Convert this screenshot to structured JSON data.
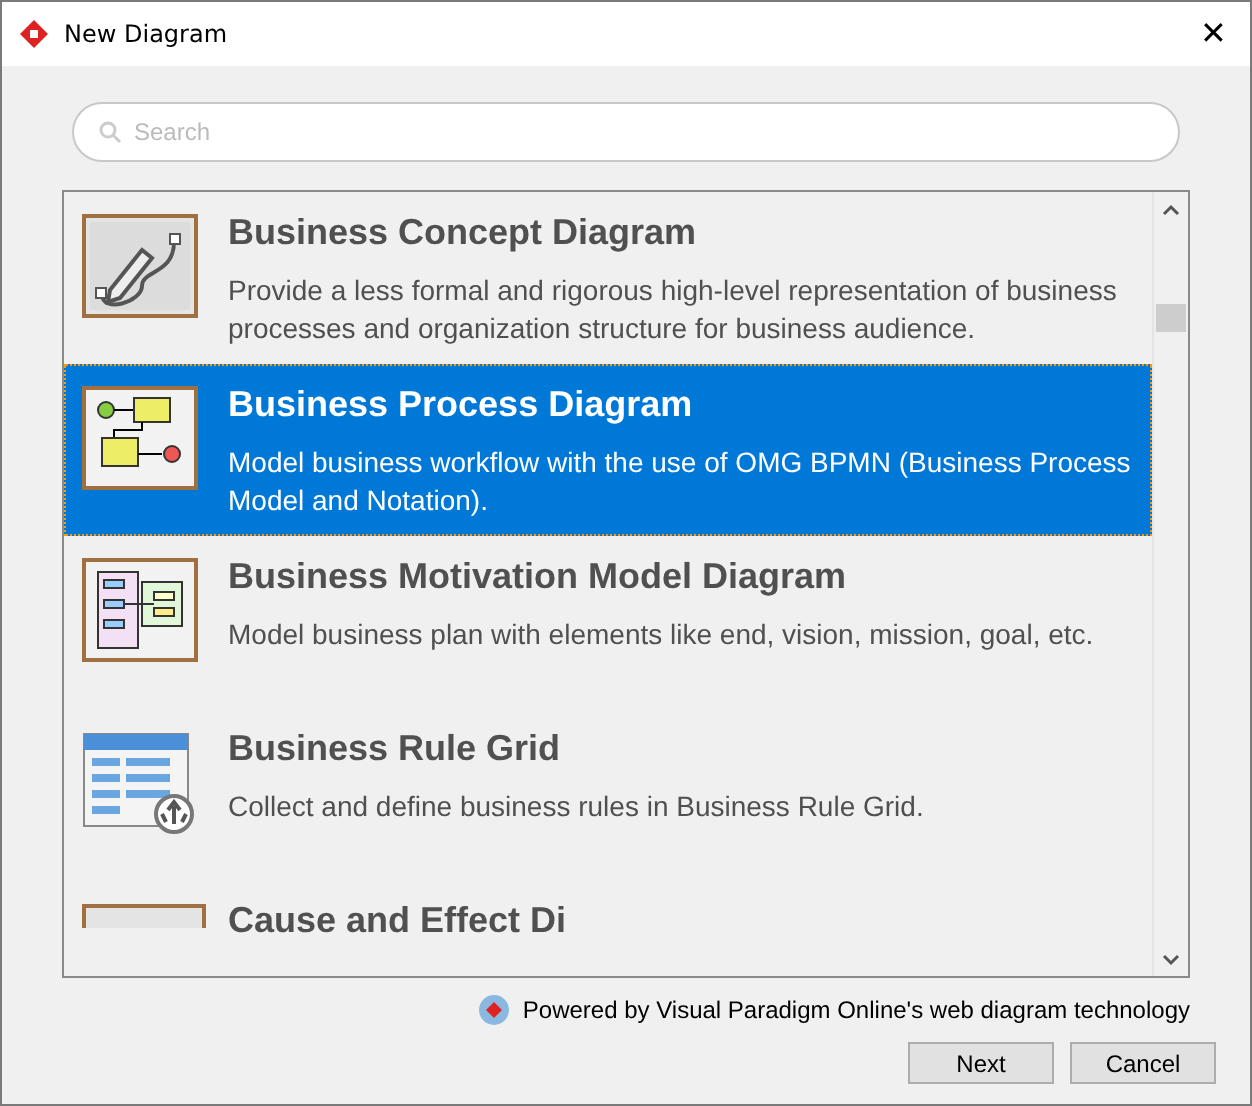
{
  "window": {
    "title": "New Diagram",
    "close": "✕"
  },
  "search": {
    "placeholder": "Search"
  },
  "diagram_types": [
    {
      "kind": "concept",
      "title": "Business Concept Diagram",
      "description": "Provide a less formal and rigorous high-level representation of business processes and organization structure for business audience.",
      "selected": false
    },
    {
      "kind": "process",
      "title": "Business Process Diagram",
      "description": "Model business workflow with the use of OMG BPMN (Business Process Model and Notation).",
      "selected": true
    },
    {
      "kind": "motivation",
      "title": "Business Motivation Model Diagram",
      "description": "Model business plan with elements like end, vision, mission, goal, etc.",
      "selected": false
    },
    {
      "kind": "rulegrid",
      "title": "Business Rule Grid",
      "description": "Collect and define business rules in Business Rule Grid.",
      "selected": false
    },
    {
      "kind": "cause",
      "title": "Cause and Effect Di",
      "selected": false
    }
  ],
  "powered_by": "Powered by Visual Paradigm Online's web diagram technology",
  "buttons": [
    "Next",
    "Cancel"
  ]
}
